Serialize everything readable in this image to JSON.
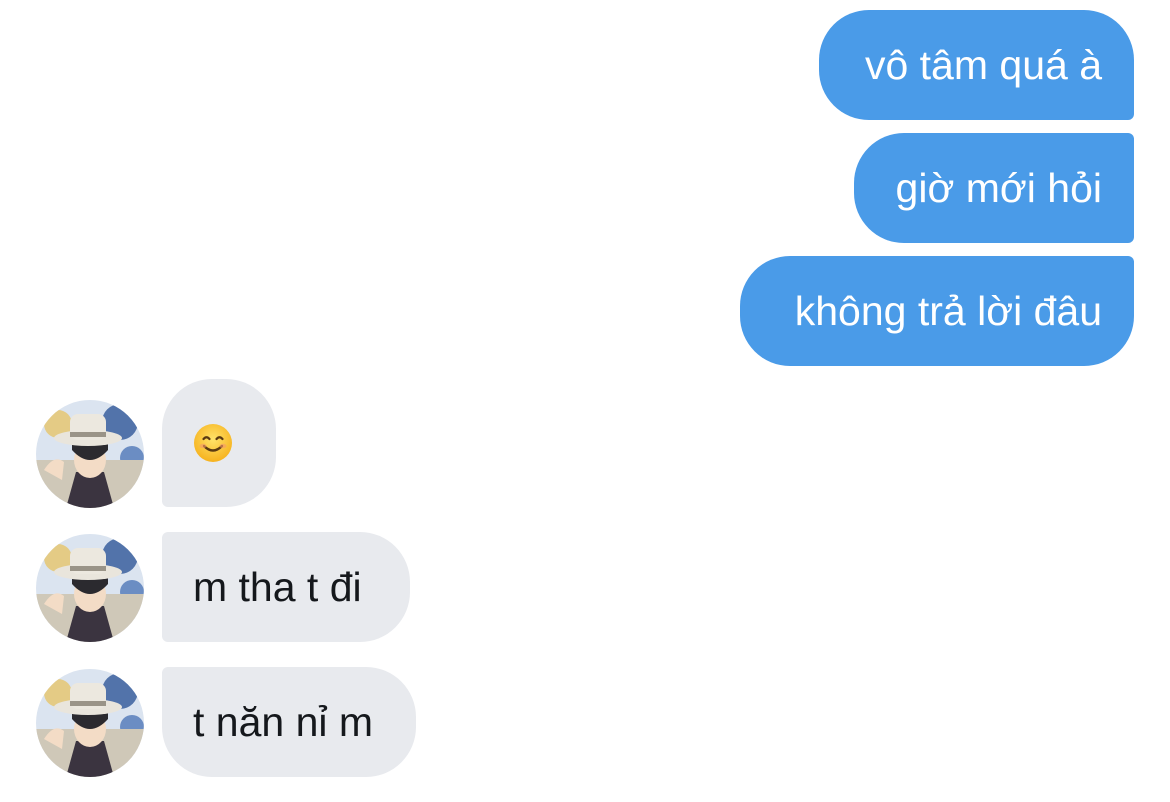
{
  "conversation": {
    "outgoing": [
      {
        "text": "vô tâm quá à"
      },
      {
        "text": "giờ mới hỏi"
      },
      {
        "text": "không trả lời đâu"
      }
    ],
    "incoming": [
      {
        "emoji": "smiling-face-emoji"
      },
      {
        "text": "m tha t đi"
      },
      {
        "text": "t năn nỉ m"
      }
    ]
  },
  "colors": {
    "outgoing_bubble": "#4a9be8",
    "incoming_bubble": "#e8eaee",
    "background": "#ffffff"
  }
}
